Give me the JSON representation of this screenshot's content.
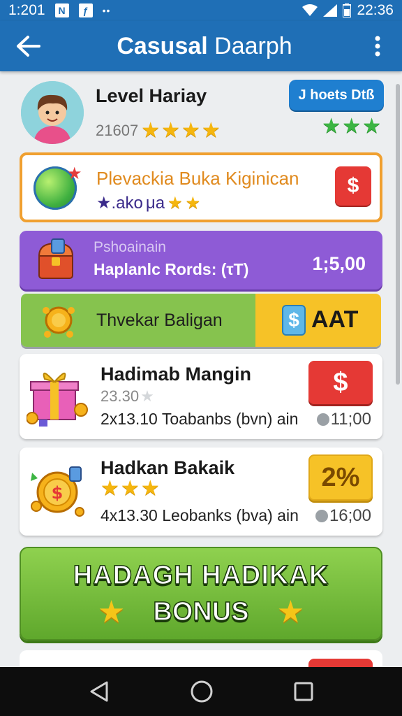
{
  "status_bar": {
    "time_left": "1:201",
    "time_right": "22:36",
    "icon_n": "N",
    "icon_2": "ƒ",
    "dots": "••"
  },
  "app_bar": {
    "title_bold": "Casusal",
    "title_rest": "Daarph"
  },
  "profile": {
    "name": "Level Hariay",
    "score": "21607",
    "button": "J hoets Dtß",
    "gold_stars": 4,
    "green_stars": 3
  },
  "offer_card": {
    "title": "Plevackia Buka Kiginican",
    "subtitle_a": "★.ako",
    "subtitle_b": "μa",
    "badge": "$"
  },
  "purple_card": {
    "label": "Pshoainain",
    "text": "Haplanlс Rords: (τT)",
    "value": "1;5,00"
  },
  "green_card": {
    "text": "Thvekar Baligan",
    "badge_symbol": "$",
    "badge_text": "AAT"
  },
  "items": [
    {
      "title": "Hadimab Mangin",
      "sub": "23.30",
      "detail": "2x13.10  Toabanbs (bvn) ain",
      "badge": "$",
      "time": "11;00"
    },
    {
      "title": "Hadkan Bakaik",
      "sub": "",
      "detail": "4x13.30  Leobanks (bva) ain",
      "badge": "2%",
      "time": "16;00"
    }
  ],
  "bonus": {
    "line1": "HADAGH HADIKAK",
    "line2": "BONUS"
  },
  "colors": {
    "primary": "#1f6fb6",
    "orange": "#f0a030",
    "purple": "#8e5bd6",
    "green": "#86c34e",
    "yellow": "#f6c227",
    "red": "#e53935"
  }
}
